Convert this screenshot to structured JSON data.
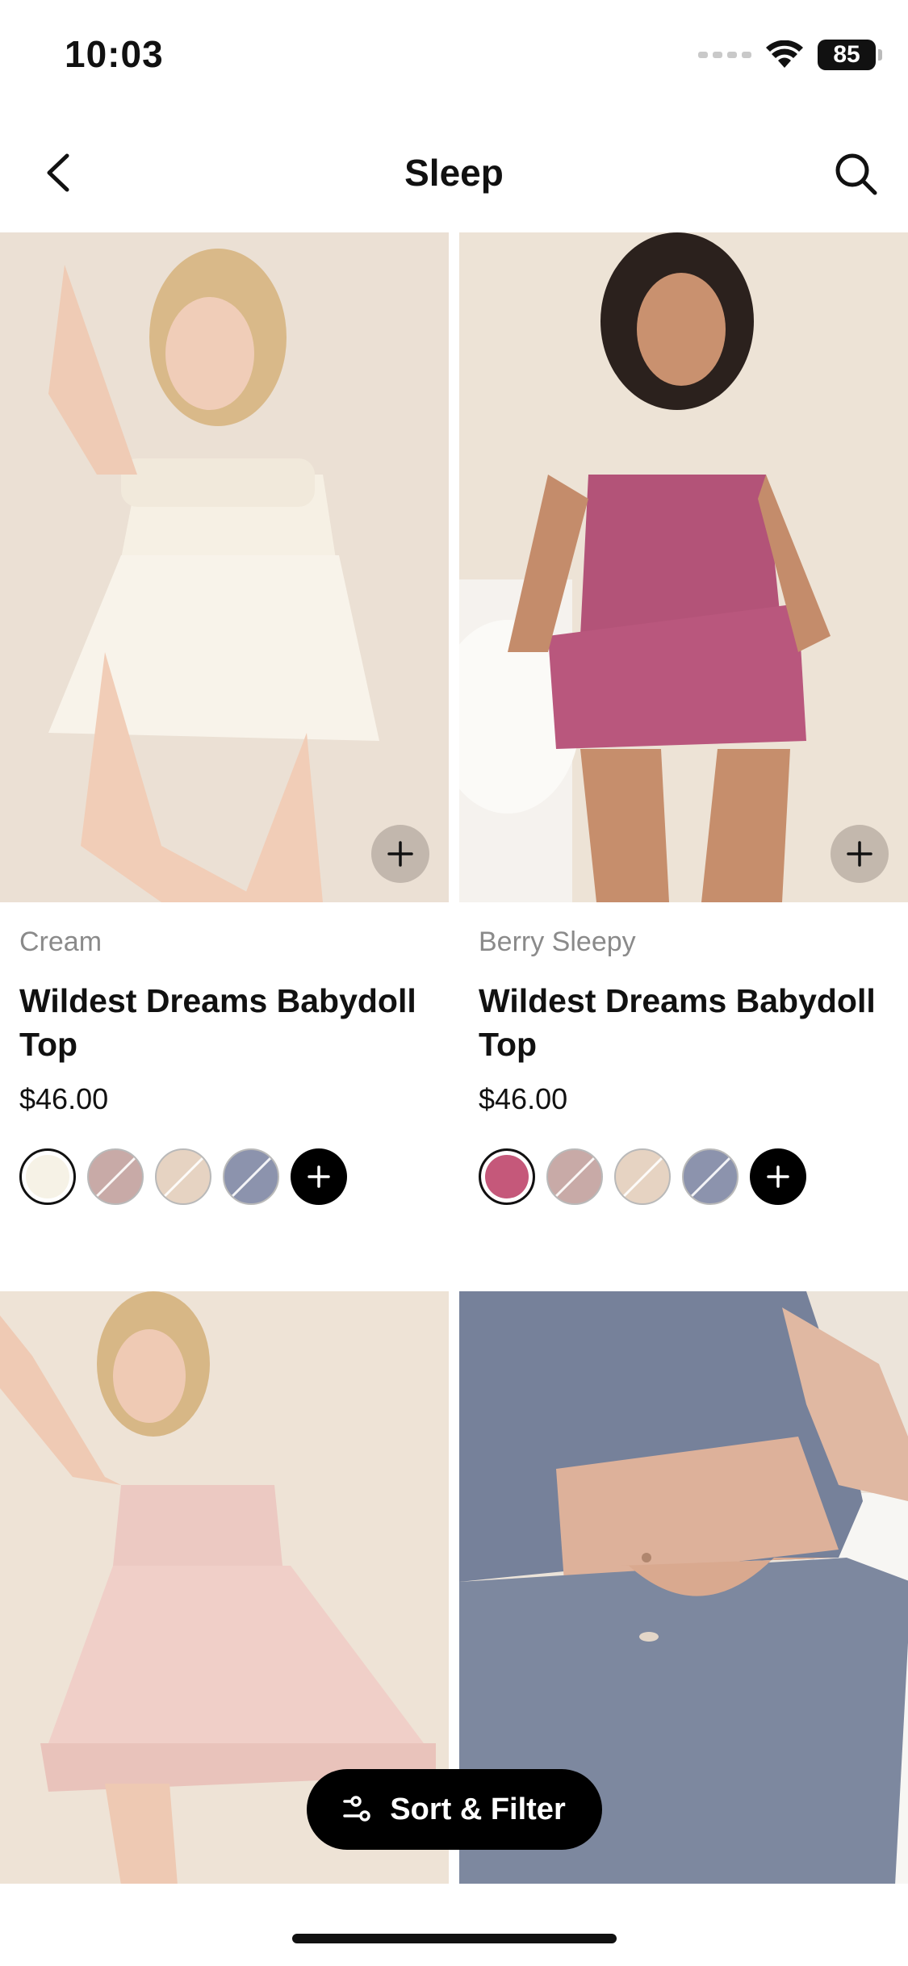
{
  "status_bar": {
    "time": "10:03",
    "battery": "85"
  },
  "nav": {
    "title": "Sleep",
    "back_icon": "chevron-left-icon",
    "search_icon": "search-icon"
  },
  "products": [
    {
      "color_name": "Cream",
      "name": "Wildest Dreams Babydoll Top",
      "price": "$46.00",
      "image": "woman in cream babydoll top and shorts",
      "swatches": [
        {
          "color": "#f6f2e6",
          "selected": true,
          "unavailable": false
        },
        {
          "color": "#c8aaa7",
          "selected": false,
          "unavailable": true
        },
        {
          "color": "#e6d3c2",
          "selected": false,
          "unavailable": true
        },
        {
          "color": "#8c93ad",
          "selected": false,
          "unavailable": true
        }
      ]
    },
    {
      "color_name": "Berry Sleepy",
      "name": "Wildest Dreams Babydoll Top",
      "price": "$46.00",
      "image": "woman in berry babydoll top and shorts",
      "swatches": [
        {
          "color": "#c5587a",
          "selected": true,
          "unavailable": false
        },
        {
          "color": "#c8aaa7",
          "selected": false,
          "unavailable": true
        },
        {
          "color": "#e6d3c2",
          "selected": false,
          "unavailable": true
        },
        {
          "color": "#8c93ad",
          "selected": false,
          "unavailable": true
        }
      ]
    },
    {
      "image": "woman in blush babydoll dress"
    },
    {
      "image": "slate blue babydoll top and shorts close-up"
    }
  ],
  "sort_filter": {
    "label": "Sort & Filter",
    "icon": "sliders-icon"
  },
  "colors": {
    "photo_bg": "#ece2d6",
    "text_primary": "#111111",
    "text_secondary": "#8a8a8a",
    "button_bg": "#000000"
  }
}
